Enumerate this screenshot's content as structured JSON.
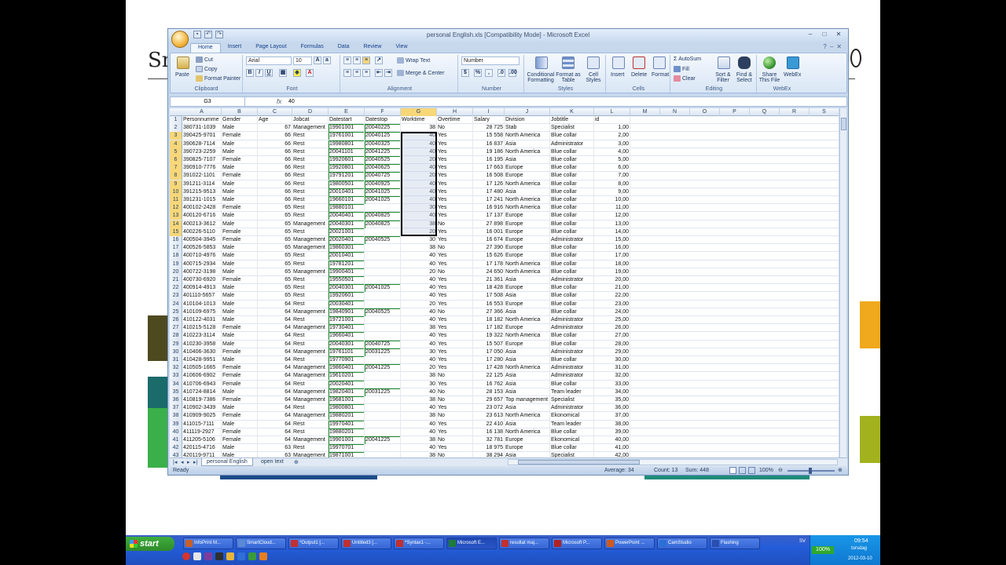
{
  "window": {
    "title": "personal English.xls  [Compatibility Mode] - Microsoft Excel"
  },
  "tabs": [
    "Home",
    "Insert",
    "Page Layout",
    "Formulas",
    "Data",
    "Review",
    "View"
  ],
  "ribbon": {
    "clipboard": {
      "label": "Clipboard",
      "paste": "Paste",
      "cut": "Cut",
      "copy": "Copy",
      "format_painter": "Format Painter"
    },
    "font": {
      "label": "Font",
      "name": "Arial",
      "size": "10"
    },
    "alignment": {
      "label": "Alignment",
      "wrap": "Wrap Text",
      "merge": "Merge & Center"
    },
    "number": {
      "label": "Number",
      "format": "Number"
    },
    "styles": {
      "label": "Styles",
      "conditional": "Conditional Formatting",
      "format_table": "Format as Table",
      "cell_styles": "Cell Styles"
    },
    "cells": {
      "label": "Cells",
      "insert": "Insert",
      "delete": "Delete",
      "format": "Format"
    },
    "editing": {
      "label": "Editing",
      "autosum": "AutoSum",
      "fill": "Fill",
      "clear": "Clear",
      "sort": "Sort & Filter",
      "find": "Find & Select"
    },
    "webex": {
      "label": "WebEx",
      "share": "Share This File",
      "webex": "WebEx"
    }
  },
  "formula_bar": {
    "name_box": "G3",
    "fx": "fx",
    "value": "40"
  },
  "columns": [
    "A",
    "B",
    "C",
    "D",
    "E",
    "F",
    "G",
    "H",
    "I",
    "J",
    "K",
    "L",
    "M",
    "N",
    "O",
    "P",
    "Q",
    "R",
    "S"
  ],
  "headers": [
    "Personnumme",
    "Gender",
    "Age",
    "Jobcat",
    "Datestart",
    "Datestop",
    "Worktime",
    "Overtime",
    "Salary",
    "Division",
    "Jobtitle",
    "id"
  ],
  "rows": [
    [
      "380731-1039",
      "Male",
      "67",
      "Management",
      "19901001",
      "20040225",
      "38",
      "No",
      "28 725",
      "Stab",
      "Specialist",
      "1,00"
    ],
    [
      "390425-9701",
      "Female",
      "66",
      "Rest",
      "19761001",
      "20040125",
      "40",
      "Yes",
      "15 558",
      "North America",
      "Blue collar",
      "2,00"
    ],
    [
      "390628-7114",
      "Male",
      "66",
      "Rest",
      "19980801",
      "20040325",
      "40",
      "Yes",
      "16 837",
      "Asia",
      "Administrator",
      "3,00"
    ],
    [
      "390723-2259",
      "Male",
      "66",
      "Rest",
      "20041101",
      "20041225",
      "40",
      "Yes",
      "19 186",
      "North America",
      "Blue collar",
      "4,00"
    ],
    [
      "390825-7107",
      "Female",
      "66",
      "Rest",
      "19920601",
      "20040525",
      "20",
      "Yes",
      "16 195",
      "Asia",
      "Blue collar",
      "5,00"
    ],
    [
      "390910-7776",
      "Male",
      "66",
      "Rest",
      "19920801",
      "20040625",
      "40",
      "Yes",
      "17 663",
      "Europe",
      "Blue collar",
      "6,00"
    ],
    [
      "391022-1101",
      "Female",
      "66",
      "Rest",
      "19791201",
      "20040725",
      "20",
      "Yes",
      "16 508",
      "Europe",
      "Blue collar",
      "7,00"
    ],
    [
      "391211-3114",
      "Male",
      "66",
      "Rest",
      "19800501",
      "20040925",
      "40",
      "Yes",
      "17 126",
      "North America",
      "Blue collar",
      "8,00"
    ],
    [
      "391215-9513",
      "Male",
      "66",
      "Rest",
      "20010401",
      "20041025",
      "40",
      "Yes",
      "17 480",
      "Asia",
      "Blue collar",
      "9,00"
    ],
    [
      "391231-1015",
      "Male",
      "66",
      "Rest",
      "19660101",
      "20041025",
      "40",
      "Yes",
      "17 241",
      "North America",
      "Blue collar",
      "10,00"
    ],
    [
      "400102-2428",
      "Female",
      "65",
      "Rest",
      "19880101",
      "",
      "30",
      "Yes",
      "16 916",
      "North America",
      "Blue collar",
      "11,00"
    ],
    [
      "400120-6716",
      "Male",
      "65",
      "Rest",
      "20040401",
      "20040825",
      "40",
      "Yes",
      "17 137",
      "Europe",
      "Blue collar",
      "12,00"
    ],
    [
      "400213-3612",
      "Male",
      "65",
      "Management",
      "20040301",
      "20040825",
      "38",
      "No",
      "27 898",
      "Europe",
      "Blue collar",
      "13,00"
    ],
    [
      "400226-5110",
      "Female",
      "65",
      "Rest",
      "20021001",
      "",
      "20",
      "Yes",
      "16 001",
      "Europe",
      "Blue collar",
      "14,00"
    ],
    [
      "400504-3945",
      "Female",
      "65",
      "Management",
      "20020401",
      "20040525",
      "30",
      "Yes",
      "16 674",
      "Europe",
      "Administrator",
      "15,00"
    ],
    [
      "400526-5853",
      "Male",
      "65",
      "Management",
      "19860301",
      "",
      "38",
      "No",
      "27 390",
      "Europe",
      "Blue collar",
      "16,00"
    ],
    [
      "400710-4976",
      "Male",
      "65",
      "Rest",
      "20010401",
      "",
      "40",
      "Yes",
      "15 626",
      "Europe",
      "Blue collar",
      "17,00"
    ],
    [
      "400715-2934",
      "Male",
      "65",
      "Rest",
      "19781201",
      "",
      "40",
      "Yes",
      "17 178",
      "North America",
      "Blue collar",
      "18,00"
    ],
    [
      "400722-3198",
      "Male",
      "65",
      "Management",
      "19900401",
      "",
      "20",
      "No",
      "24 650",
      "North America",
      "Blue collar",
      "19,00"
    ],
    [
      "400730-6920",
      "Female",
      "65",
      "Rest",
      "19550501",
      "",
      "40",
      "Yes",
      "21 361",
      "Asia",
      "Administrator",
      "20,00"
    ],
    [
      "400914-4913",
      "Male",
      "65",
      "Rest",
      "20040301",
      "20041025",
      "40",
      "Yes",
      "18 428",
      "Europe",
      "Blue collar",
      "21,00"
    ],
    [
      "401110-5657",
      "Male",
      "65",
      "Rest",
      "19920601",
      "",
      "40",
      "Yes",
      "17 508",
      "Asia",
      "Blue collar",
      "22,00"
    ],
    [
      "410104-1013",
      "Male",
      "64",
      "Rest",
      "20030401",
      "",
      "20",
      "Yes",
      "16 553",
      "Europe",
      "Blue collar",
      "23,00"
    ],
    [
      "410109-6975",
      "Male",
      "64",
      "Management",
      "19840901",
      "20040525",
      "40",
      "No",
      "27 366",
      "Asia",
      "Blue collar",
      "24,00"
    ],
    [
      "410122-4031",
      "Male",
      "64",
      "Rest",
      "19721001",
      "",
      "40",
      "Yes",
      "18 182",
      "North America",
      "Administrator",
      "25,00"
    ],
    [
      "410215-5128",
      "Female",
      "64",
      "Management",
      "19730401",
      "",
      "38",
      "Yes",
      "17 182",
      "Europe",
      "Administrator",
      "26,00"
    ],
    [
      "410223-3114",
      "Male",
      "64",
      "Rest",
      "19660401",
      "",
      "40",
      "Yes",
      "19 322",
      "North America",
      "Blue collar",
      "27,00"
    ],
    [
      "410230-3958",
      "Male",
      "64",
      "Rest",
      "20040301",
      "20040725",
      "40",
      "Yes",
      "15 507",
      "Europe",
      "Blue collar",
      "28,00"
    ],
    [
      "410406-3630",
      "Female",
      "64",
      "Management",
      "19761101",
      "20031225",
      "30",
      "Yes",
      "17 050",
      "Asia",
      "Administrator",
      "29,00"
    ],
    [
      "410428-9951",
      "Male",
      "64",
      "Rest",
      "19770901",
      "",
      "40",
      "Yes",
      "17 280",
      "Asia",
      "Blue collar",
      "30,00"
    ],
    [
      "410505-1665",
      "Female",
      "64",
      "Management",
      "19860401",
      "20041225",
      "20",
      "Yes",
      "17 428",
      "North America",
      "Administrator",
      "31,00"
    ],
    [
      "410606-6902",
      "Female",
      "64",
      "Management",
      "19610201",
      "",
      "38",
      "No",
      "22 125",
      "Asia",
      "Administrator",
      "32,00"
    ],
    [
      "410706-6943",
      "Female",
      "64",
      "Rest",
      "20020401",
      "",
      "30",
      "Yes",
      "16 762",
      "Asia",
      "Blue collar",
      "33,00"
    ],
    [
      "410724-8814",
      "Male",
      "64",
      "Management",
      "19820401",
      "20031225",
      "40",
      "No",
      "28 153",
      "Asia",
      "Team leader",
      "34,00"
    ],
    [
      "410819-7386",
      "Female",
      "64",
      "Management",
      "19681001",
      "",
      "38",
      "No",
      "29 657",
      "Top management",
      "Specialist",
      "35,00"
    ],
    [
      "410902-3439",
      "Male",
      "64",
      "Rest",
      "19800801",
      "",
      "40",
      "Yes",
      "23 072",
      "Asia",
      "Administrator",
      "36,00"
    ],
    [
      "410909-9025",
      "Female",
      "64",
      "Management",
      "19880201",
      "",
      "38",
      "No",
      "23 613",
      "North America",
      "Ekonomical",
      "37,00"
    ],
    [
      "411015-7111",
      "Male",
      "64",
      "Rest",
      "19970401",
      "",
      "40",
      "Yes",
      "22 410",
      "Asia",
      "Team leader",
      "38,00"
    ],
    [
      "411119-2927",
      "Female",
      "64",
      "Rest",
      "19880201",
      "",
      "40",
      "Yes",
      "16 138",
      "North America",
      "Blue collar",
      "39,00"
    ],
    [
      "411205-5106",
      "Female",
      "64",
      "Management",
      "19901001",
      "20041225",
      "38",
      "No",
      "32 781",
      "Europe",
      "Ekonomical",
      "40,00"
    ],
    [
      "420115-4716",
      "Male",
      "63",
      "Rest",
      "19970701",
      "",
      "40",
      "Yes",
      "18 975",
      "Europe",
      "Blue collar",
      "41,00"
    ],
    [
      "420119-9711",
      "Male",
      "63",
      "Management",
      "19871001",
      "",
      "38",
      "No",
      "38 294",
      "Asia",
      "Specialist",
      "42,00"
    ]
  ],
  "sheets": [
    "personal English",
    "open text"
  ],
  "status": {
    "ready": "Ready",
    "average": "Average: 34",
    "count": "Count: 13",
    "sum": "Sum: 448",
    "zoom": "100%"
  },
  "taskbar": {
    "start": "start",
    "buttons": [
      "InfoPrint M...",
      "SmartCloud...",
      "*Output1 [...",
      "Untitled3 [...",
      "*Syntax1 -...",
      "Microsoft E...",
      "resultat maj...",
      "Microsoft P...",
      "PowerPoint ...",
      "CamStudio",
      "Flashing"
    ],
    "battery": "100%",
    "lang": "SV",
    "time": "09:54",
    "day": "torsdag",
    "date": "2012-03-10"
  },
  "colors": {
    "accent": "#f8d779",
    "brand_green": "#1e7b3a"
  }
}
